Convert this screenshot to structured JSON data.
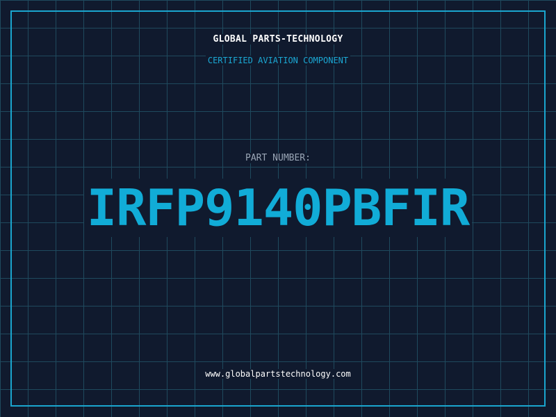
{
  "header": {
    "company": "GLOBAL PARTS-TECHNOLOGY",
    "subtitle": "CERTIFIED AVIATION COMPONENT"
  },
  "part": {
    "label": "PART NUMBER:",
    "number": "IRFP9140PBFIR"
  },
  "footer": {
    "url": "www.globalpartstechnology.com"
  },
  "colors": {
    "background": "#101a2e",
    "grid": "#1f4a5e",
    "accent": "#11acd7",
    "frame": "#1aa6cf"
  }
}
